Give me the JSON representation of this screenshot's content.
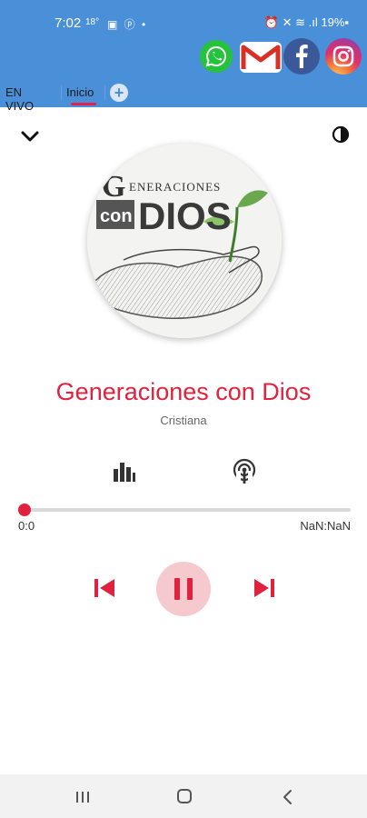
{
  "status_bar": {
    "time": "7:02",
    "sub": "18°",
    "icons": "▣ ⓟ •",
    "right": "⏰ ✕ ≋ .ıl 19%▪"
  },
  "tabs": [
    {
      "label": "EN VIVO"
    },
    {
      "label": "Inicio"
    }
  ],
  "add_tab_label": "+",
  "cover": {
    "line1": "ENERACIONES",
    "line1_initial": "G",
    "con": "con",
    "dios": "DIOS"
  },
  "station": {
    "title": "Generaciones con Dios",
    "genre": "Cristiana"
  },
  "progress": {
    "current": "0:0",
    "duration": "NaN:NaN",
    "fraction": 0
  },
  "social_links": [
    "whatsapp-icon",
    "gmail-icon",
    "facebook-icon",
    "instagram-icon"
  ],
  "colors": {
    "accent": "#e0223e",
    "header": "#4a90d8"
  }
}
